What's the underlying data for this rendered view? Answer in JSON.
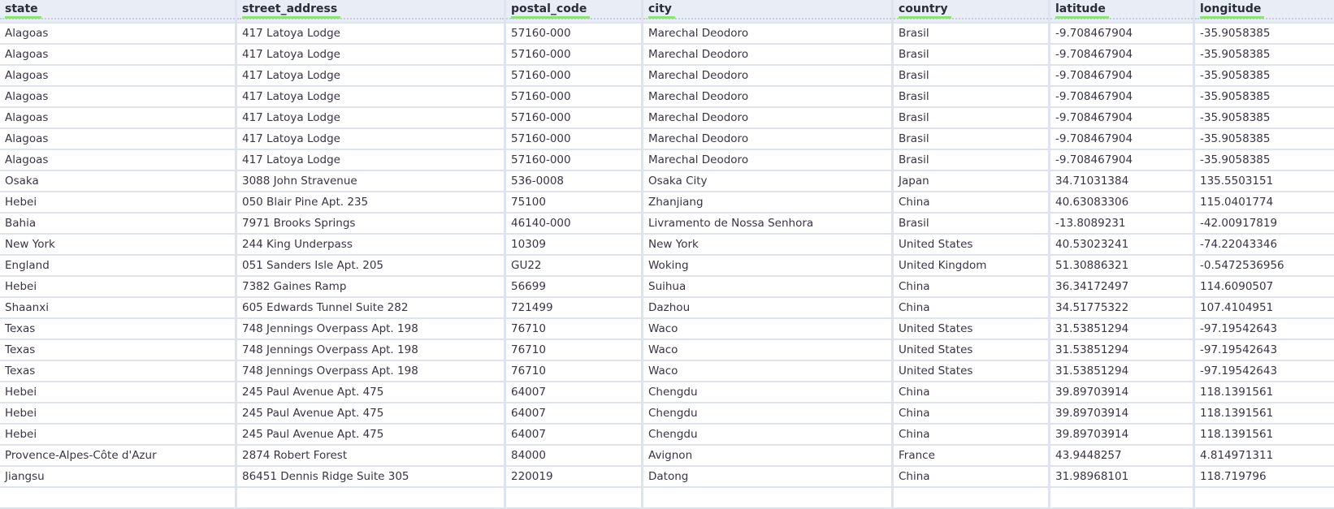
{
  "columns": [
    "state",
    "street_address",
    "postal_code",
    "city",
    "country",
    "latitude",
    "longitude"
  ],
  "rows": [
    [
      "Alagoas",
      "417 Latoya Lodge",
      "57160-000",
      "Marechal Deodoro",
      "Brasil",
      "-9.708467904",
      "-35.9058385"
    ],
    [
      "Alagoas",
      "417 Latoya Lodge",
      "57160-000",
      "Marechal Deodoro",
      "Brasil",
      "-9.708467904",
      "-35.9058385"
    ],
    [
      "Alagoas",
      "417 Latoya Lodge",
      "57160-000",
      "Marechal Deodoro",
      "Brasil",
      "-9.708467904",
      "-35.9058385"
    ],
    [
      "Alagoas",
      "417 Latoya Lodge",
      "57160-000",
      "Marechal Deodoro",
      "Brasil",
      "-9.708467904",
      "-35.9058385"
    ],
    [
      "Alagoas",
      "417 Latoya Lodge",
      "57160-000",
      "Marechal Deodoro",
      "Brasil",
      "-9.708467904",
      "-35.9058385"
    ],
    [
      "Alagoas",
      "417 Latoya Lodge",
      "57160-000",
      "Marechal Deodoro",
      "Brasil",
      "-9.708467904",
      "-35.9058385"
    ],
    [
      "Alagoas",
      "417 Latoya Lodge",
      "57160-000",
      "Marechal Deodoro",
      "Brasil",
      "-9.708467904",
      "-35.9058385"
    ],
    [
      "Osaka",
      "3088 John Stravenue",
      "536-0008",
      "Osaka City",
      "Japan",
      "34.71031384",
      "135.5503151"
    ],
    [
      "Hebei",
      "050 Blair Pine Apt. 235",
      "75100",
      "Zhanjiang",
      "China",
      "40.63083306",
      "115.0401774"
    ],
    [
      "Bahia",
      "7971 Brooks Springs",
      "46140-000",
      "Livramento de Nossa Senhora",
      "Brasil",
      "-13.8089231",
      "-42.00917819"
    ],
    [
      "New York",
      "244 King Underpass",
      "10309",
      "New York",
      "United States",
      "40.53023241",
      "-74.22043346"
    ],
    [
      "England",
      "051 Sanders Isle Apt. 205",
      "GU22",
      "Woking",
      "United Kingdom",
      "51.30886321",
      "-0.5472536956"
    ],
    [
      "Hebei",
      "7382 Gaines Ramp",
      "56699",
      "Suihua",
      "China",
      "36.34172497",
      "114.6090507"
    ],
    [
      "Shaanxi",
      "605 Edwards Tunnel Suite 282",
      "721499",
      "Dazhou",
      "China",
      "34.51775322",
      "107.4104951"
    ],
    [
      "Texas",
      "748 Jennings Overpass Apt. 198",
      "76710",
      "Waco",
      "United States",
      "31.53851294",
      "-97.19542643"
    ],
    [
      "Texas",
      "748 Jennings Overpass Apt. 198",
      "76710",
      "Waco",
      "United States",
      "31.53851294",
      "-97.19542643"
    ],
    [
      "Texas",
      "748 Jennings Overpass Apt. 198",
      "76710",
      "Waco",
      "United States",
      "31.53851294",
      "-97.19542643"
    ],
    [
      "Hebei",
      "245 Paul Avenue Apt. 475",
      "64007",
      "Chengdu",
      "China",
      "39.89703914",
      "118.1391561"
    ],
    [
      "Hebei",
      "245 Paul Avenue Apt. 475",
      "64007",
      "Chengdu",
      "China",
      "39.89703914",
      "118.1391561"
    ],
    [
      "Hebei",
      "245 Paul Avenue Apt. 475",
      "64007",
      "Chengdu",
      "China",
      "39.89703914",
      "118.1391561"
    ],
    [
      "Provence-Alpes-Côte d'Azur",
      "2874 Robert Forest",
      "84000",
      "Avignon",
      "France",
      "43.9448257",
      "4.814971311"
    ],
    [
      "Jiangsu",
      "86451 Dennis Ridge Suite 305",
      "220019",
      "Datong",
      "China",
      "31.98968101",
      "118.719796"
    ]
  ]
}
